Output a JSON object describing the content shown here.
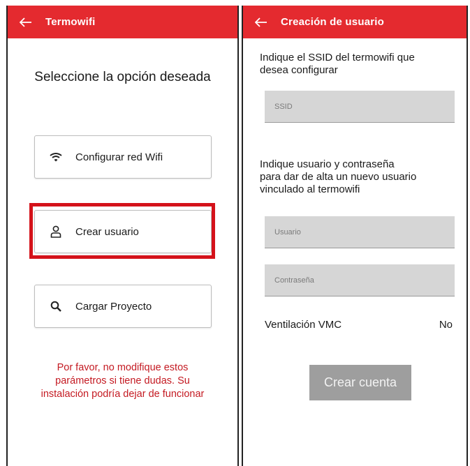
{
  "left_screen": {
    "appbar": {
      "title": "Termowifi",
      "back_icon": "arrow-left-icon"
    },
    "prompt": "Seleccione la opción deseada",
    "options": [
      {
        "label": "Configurar red Wifi",
        "icon": "wifi-icon"
      },
      {
        "label": "Crear usuario",
        "icon": "user-icon"
      },
      {
        "label": "Cargar Proyecto",
        "icon": "search-icon"
      }
    ],
    "highlight_color": "#d4121a",
    "warning": {
      "line1": "Por favor, no modifique estos",
      "line2": "parámetros si tiene dudas. Su",
      "line3": "instalación podría dejar de funcionar"
    }
  },
  "right_screen": {
    "appbar": {
      "title": "Creación de usuario",
      "back_icon": "arrow-left-icon"
    },
    "ssid_label": {
      "line1": "Indique el SSID del termowifi que",
      "line2": "desea configurar"
    },
    "ssid_field": {
      "placeholder": "SSID",
      "value": ""
    },
    "user_label": {
      "line1": "Indique usuario y contraseña",
      "line2": "para dar de alta un nuevo usuario",
      "line3": "vinculado al termowifi"
    },
    "user_field": {
      "placeholder": "Usuario",
      "value": ""
    },
    "password_field": {
      "placeholder": "Contraseña",
      "value": ""
    },
    "vmc": {
      "label": "Ventilación VMC",
      "value": "No"
    },
    "create_button": {
      "label": "Crear cuenta"
    }
  },
  "colors": {
    "appbar": "#e42a2f",
    "warning_text": "#c41a22",
    "field_bg": "#d6d6d6",
    "button_bg": "#9e9e9e"
  }
}
